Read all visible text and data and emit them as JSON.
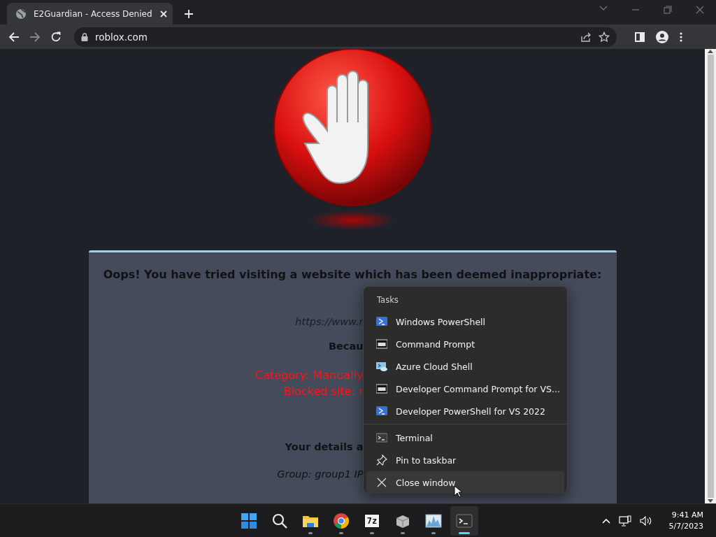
{
  "browser": {
    "tab": {
      "title": "E2Guardian - Access Denied",
      "selected": true
    },
    "url": "roblox.com",
    "forward_disabled": true
  },
  "page": {
    "heading": "Oops! You have tried visiting a website which has been deemed inappropriate:",
    "lines": [
      {
        "kind": "url",
        "text": "https://www.r"
      },
      {
        "kind": "bold",
        "text": "Becau"
      },
      {
        "kind": "alert",
        "text": "Category: Manually"
      },
      {
        "kind": "alert",
        "text": "Blocked site: r"
      },
      {
        "kind": "bold",
        "text": "Your details a"
      },
      {
        "kind": "detail",
        "text": "Group: group1   IP"
      }
    ]
  },
  "jump_list": {
    "header": "Tasks",
    "tasks": [
      {
        "kind": "powershell",
        "label": "Windows PowerShell",
        "hovered": false
      },
      {
        "kind": "cmd",
        "label": "Command Prompt",
        "hovered": false
      },
      {
        "kind": "azure",
        "label": "Azure Cloud Shell",
        "hovered": false
      },
      {
        "kind": "cmd",
        "label": "Developer Command Prompt for VS...",
        "hovered": false
      },
      {
        "kind": "powershell",
        "label": "Developer PowerShell for VS 2022",
        "hovered": false
      }
    ],
    "actions": [
      {
        "kind": "terminal",
        "label": "Terminal",
        "hovered": false
      },
      {
        "kind": "pin",
        "label": "Pin to taskbar",
        "hovered": false
      },
      {
        "kind": "close",
        "label": "Close window",
        "hovered": true
      }
    ]
  },
  "taskbar": {
    "apps": [
      {
        "kind": "start",
        "running": false,
        "active": false
      },
      {
        "kind": "search",
        "running": false,
        "active": false
      },
      {
        "kind": "explorer",
        "running": true,
        "active": false
      },
      {
        "kind": "chrome",
        "running": true,
        "active": false
      },
      {
        "kind": "archiver",
        "glyph": "7z",
        "running": true,
        "active": false
      },
      {
        "kind": "package",
        "running": true,
        "active": false
      },
      {
        "kind": "monitor",
        "running": true,
        "active": false
      },
      {
        "kind": "terminal",
        "running": true,
        "active": true
      }
    ],
    "time": "9:41 AM",
    "date": "5/7/2023"
  }
}
